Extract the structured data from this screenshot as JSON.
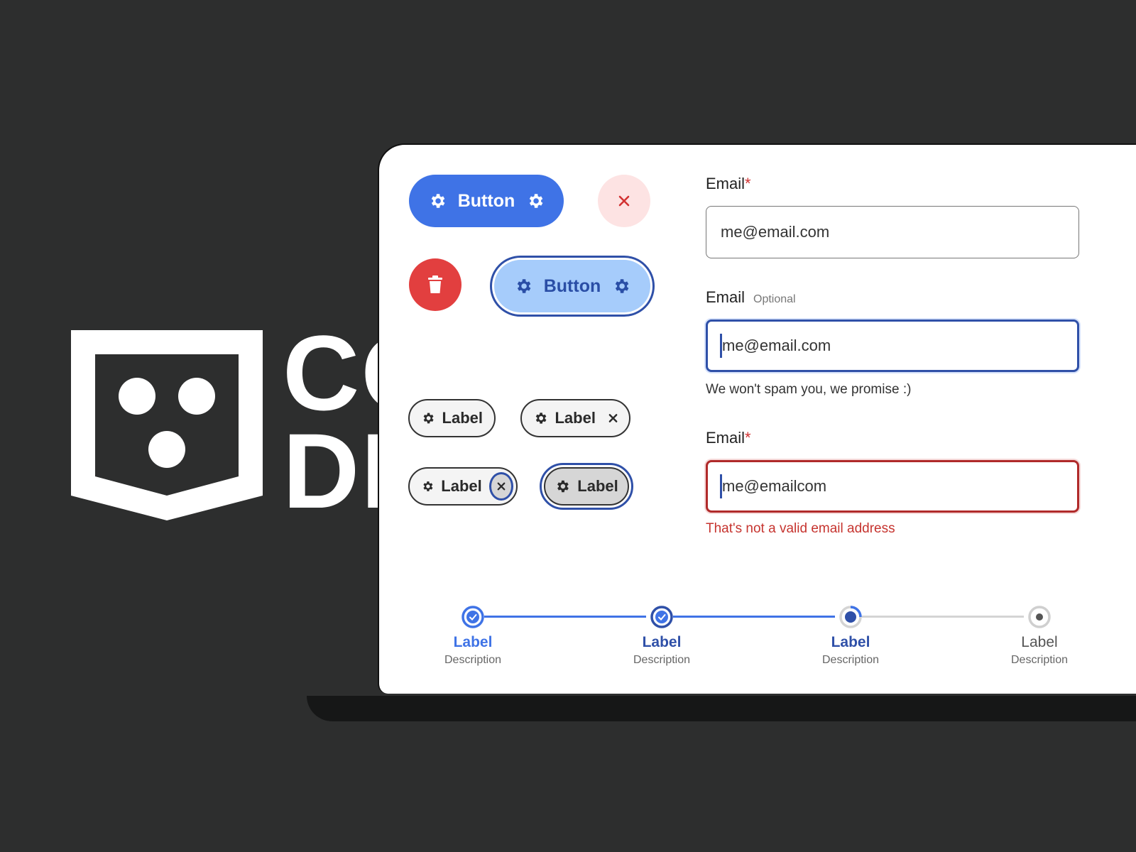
{
  "brand": {
    "text_line1": "CO",
    "text_line2": "DE"
  },
  "buttons": {
    "primary_label": "Button",
    "focused_label": "Button",
    "close_icon": "close-icon",
    "delete_icon": "trash-icon"
  },
  "chips": [
    {
      "label": "Label",
      "removable": false,
      "state": "default"
    },
    {
      "label": "Label",
      "removable": true,
      "state": "default"
    },
    {
      "label": "Label",
      "removable": true,
      "state": "remove-focused"
    },
    {
      "label": "Label",
      "removable": false,
      "state": "focused"
    }
  ],
  "form": {
    "fields": [
      {
        "label": "Email",
        "required_marker": "*",
        "value": "me@email.com"
      },
      {
        "label": "Email",
        "optional_text": "Optional",
        "value": "me@email.com",
        "helper": "We won't spam you, we promise :)"
      },
      {
        "label": "Email",
        "required_marker": "*",
        "value": "me@emailcom",
        "error": "That's not a valid email address"
      }
    ]
  },
  "stepper": {
    "steps": [
      {
        "label": "Label",
        "description": "Description",
        "status": "complete"
      },
      {
        "label": "Label",
        "description": "Description",
        "status": "complete"
      },
      {
        "label": "Label",
        "description": "Description",
        "status": "current"
      },
      {
        "label": "Label",
        "description": "Description",
        "status": "upcoming"
      }
    ]
  },
  "colors": {
    "background": "#2d2e2e",
    "primary": "#3f73e6",
    "focus": "#2f50a8",
    "danger": "#e23f3f",
    "error_text": "#c6342f"
  }
}
